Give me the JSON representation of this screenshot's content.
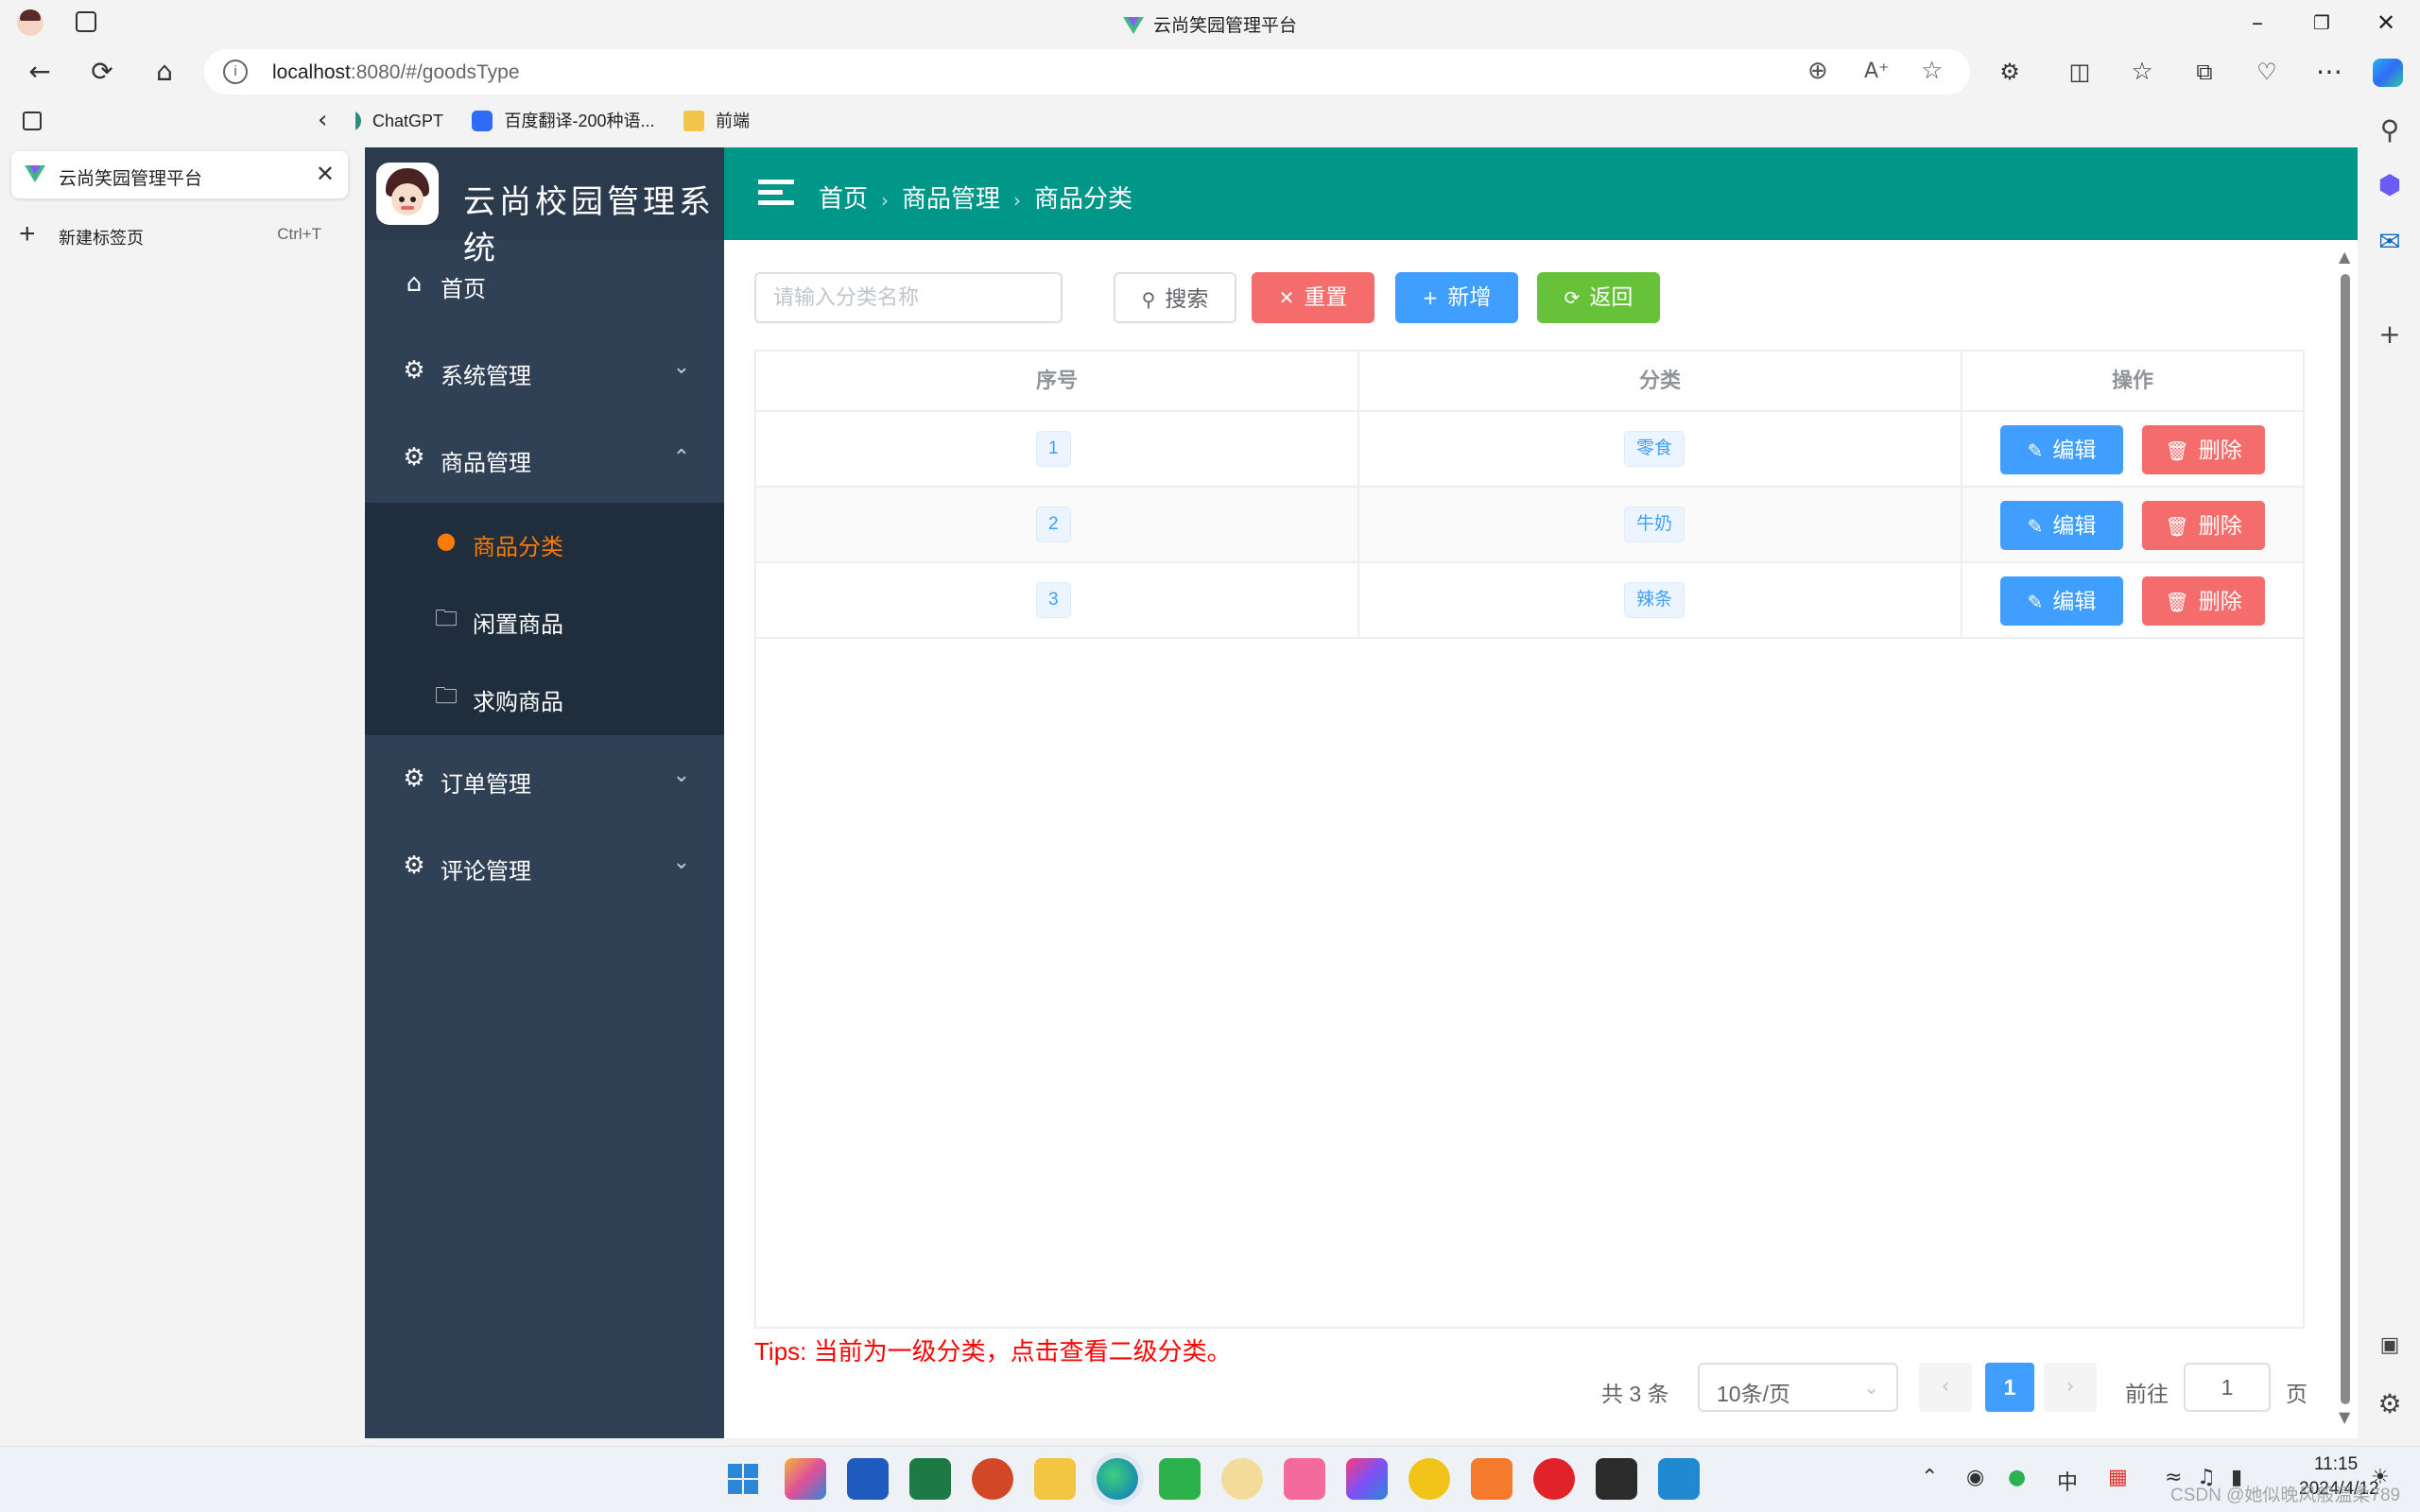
{
  "browser": {
    "window_title": "云尚笑园管理平台",
    "url_host": "localhost",
    "url_path": ":8080/#/goodsType",
    "bookmarks": [
      {
        "label": "ChatGPT",
        "color": "#2a8c7c"
      },
      {
        "label": "百度翻译-200种语...",
        "color": "#2e6cf6"
      },
      {
        "label": "前端",
        "color": "#f3c44a"
      }
    ],
    "tabs": {
      "active_label": "云尚笑园管理平台",
      "new_tab_label": "新建标签页",
      "new_tab_shortcut": "Ctrl+T"
    }
  },
  "app": {
    "brand": "云尚校园管理系统",
    "theme_color": "#009688",
    "sidebar_bg": "#304156",
    "menu": {
      "home": "首页",
      "system": "系统管理",
      "goods": "商品管理",
      "goods_sub": [
        "商品分类",
        "闲置商品",
        "求购商品"
      ],
      "orders": "订单管理",
      "comments": "评论管理"
    },
    "breadcrumb": [
      "首页",
      "商品管理",
      "商品分类"
    ],
    "toolbar": {
      "search_placeholder": "请输入分类名称",
      "search_label": "搜索",
      "reset_label": "重置",
      "add_label": "新增",
      "back_label": "返回"
    },
    "table": {
      "columns": [
        "序号",
        "分类",
        "操作"
      ],
      "rows": [
        {
          "index": "1",
          "category": "零食"
        },
        {
          "index": "2",
          "category": "牛奶"
        },
        {
          "index": "3",
          "category": "辣条"
        }
      ],
      "edit_label": "编辑",
      "delete_label": "删除"
    },
    "tips": "Tips: 当前为一级分类，点击查看二级分类。",
    "pagination": {
      "total_text": "共 3 条",
      "page_size": "10条/页",
      "current_page": "1",
      "goto_label": "前往",
      "goto_value": "1",
      "page_suffix": "页"
    }
  },
  "taskbar": {
    "time": "11:15",
    "date": "2024/4/12",
    "ime": "中",
    "watermark": "CSDN @她似晚风般温柔789"
  }
}
